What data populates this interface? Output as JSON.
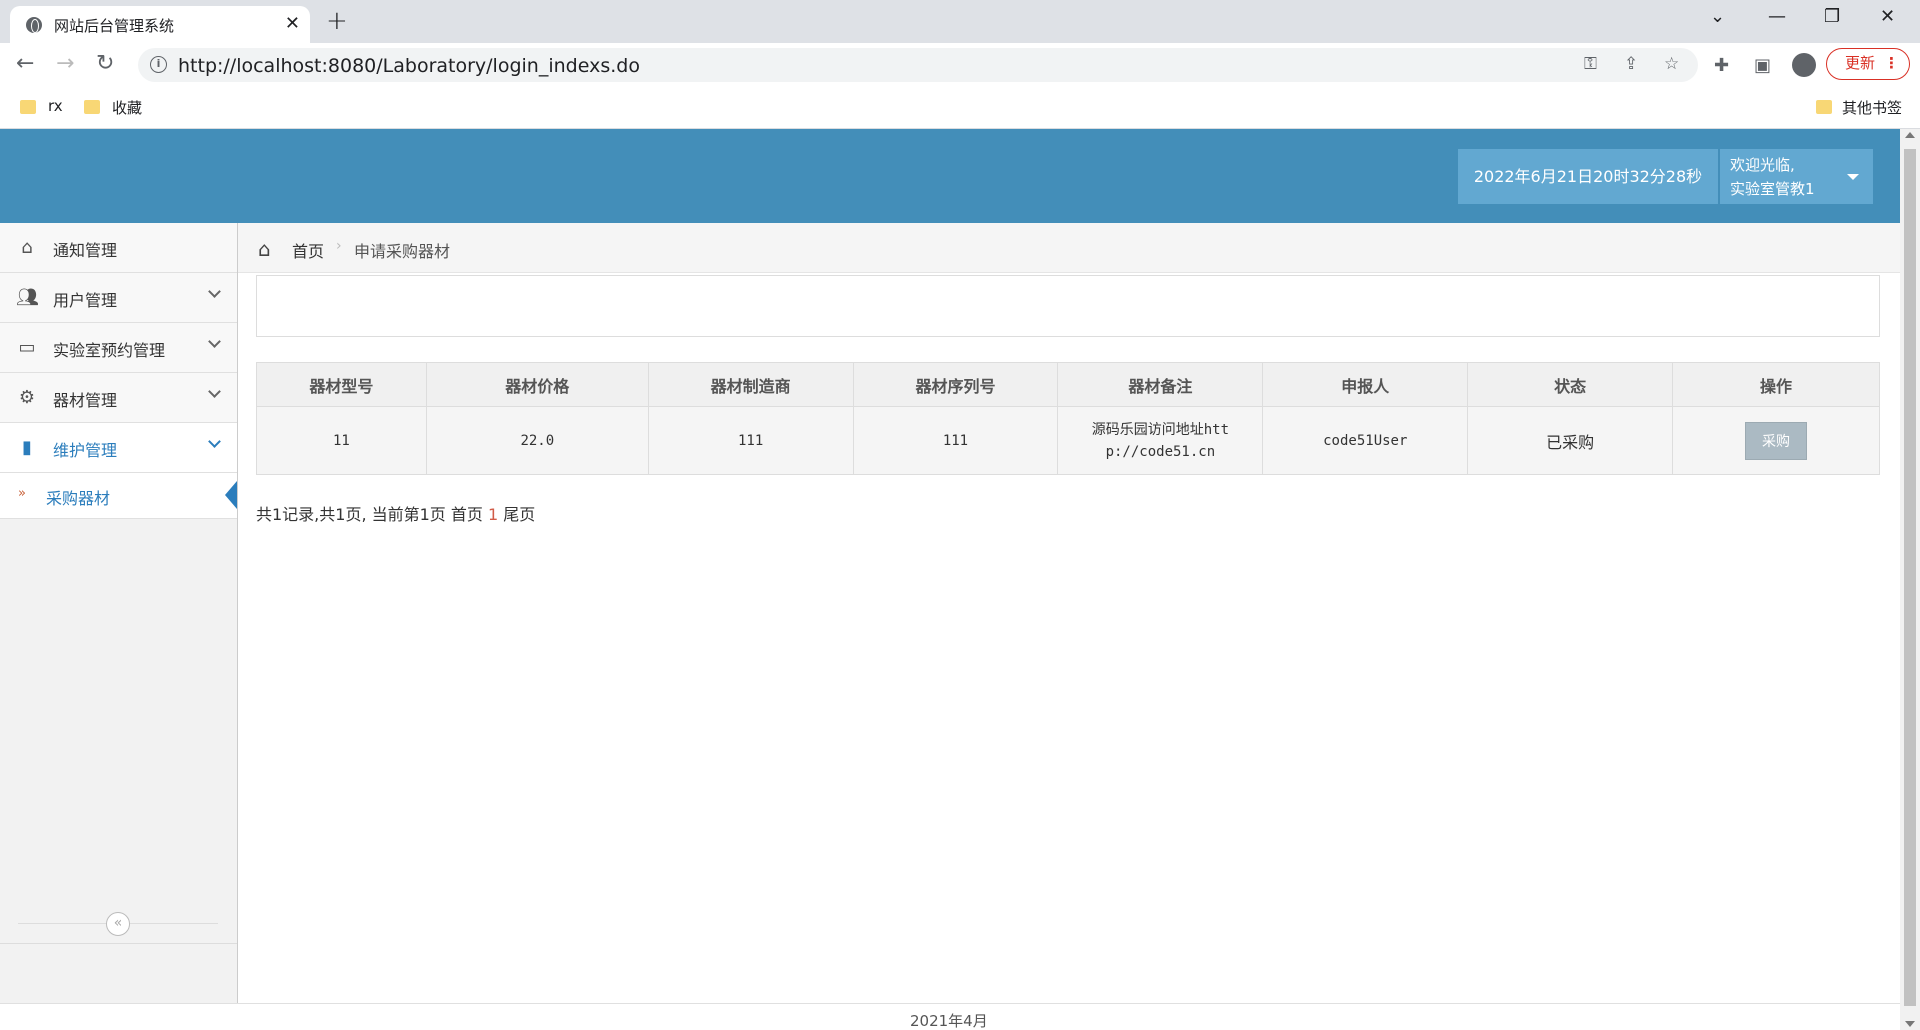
{
  "browser": {
    "tab_title": "网站后台管理系统",
    "url": "http://localhost:8080/Laboratory/login_indexs.do",
    "update_label": "更新",
    "bookmarks": [
      "rx",
      "收藏"
    ],
    "other_bookmarks": "其他书签"
  },
  "header": {
    "datetime": "2022年6月21日20时32分28秒",
    "welcome": "欢迎光临,",
    "username": "实验室管教1"
  },
  "sidebar": {
    "items": [
      {
        "label": "通知管理",
        "icon": "home-icon"
      },
      {
        "label": "用户管理",
        "icon": "users-icon"
      },
      {
        "label": "实验室预约管理",
        "icon": "desktop-icon"
      },
      {
        "label": "器材管理",
        "icon": "cogs-icon"
      },
      {
        "label": "维护管理",
        "icon": "bookmark-icon"
      }
    ],
    "subitem": "采购器材"
  },
  "breadcrumbs": {
    "home": "首页",
    "current": "申请采购器材"
  },
  "table": {
    "headers": [
      "器材型号",
      "器材价格",
      "器材制造商",
      "器材序列号",
      "器材备注",
      "申报人",
      "状态",
      "操作"
    ],
    "rows": [
      {
        "model": "11",
        "price": "22.0",
        "maker": "111",
        "serial": "111",
        "note_line1": "源码乐园访问地址htt",
        "note_line2": "p://code51.cn",
        "applicant": "code51User",
        "status": "已采购",
        "action": "采购"
      }
    ]
  },
  "pager": {
    "summary": "共1记录,共1页, 当前第1页 首页",
    "current": "1",
    "last": "尾页"
  },
  "footer": "2021年4月"
}
